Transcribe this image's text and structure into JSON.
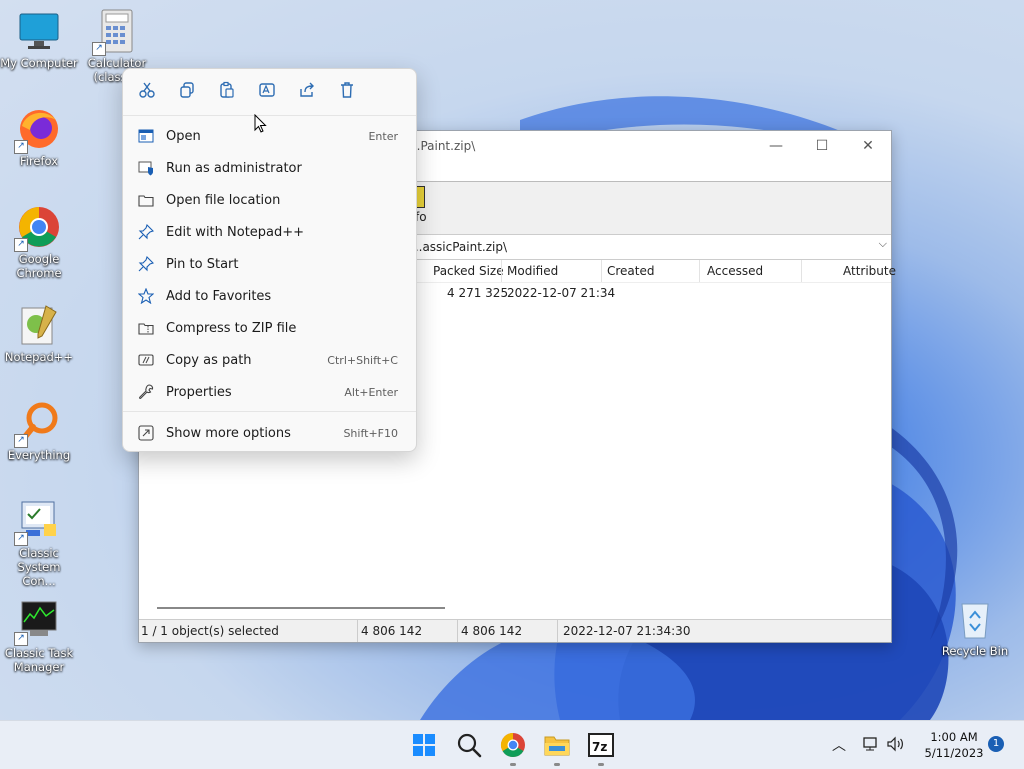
{
  "desktop": {
    "icons": [
      {
        "label": "My Computer"
      },
      {
        "label": "Calculator (classic)"
      },
      {
        "label": "Firefox"
      },
      {
        "label": "Google Chrome"
      },
      {
        "label": "Notepad++"
      },
      {
        "label": "Everything"
      },
      {
        "label": "Classic System Con..."
      },
      {
        "label": "Classic Task Manager"
      },
      {
        "label": "Recycle Bin"
      }
    ]
  },
  "window": {
    "title": "...Paint.zip\\",
    "toolbar_info_label": "fo",
    "address_path": "...assicPaint.zip\\",
    "columns": [
      "Packed Size",
      "Modified",
      "Created",
      "Accessed",
      "Attribute"
    ],
    "row": {
      "packed_size": "4 271 325",
      "modified": "2022-12-07 21:34"
    },
    "status": {
      "selected": "1 / 1 object(s) selected",
      "size": "4 806 142",
      "packed": "4 806 142",
      "date": "2022-12-07 21:34:30"
    }
  },
  "context_menu": {
    "quick_actions": [
      "cut-icon",
      "copy-icon",
      "paste-icon",
      "rename-icon",
      "share-icon",
      "delete-icon"
    ],
    "items": [
      {
        "label": "Open",
        "shortcut": "Enter",
        "icon": "open-icon"
      },
      {
        "label": "Run as administrator",
        "shortcut": "",
        "icon": "shield-icon"
      },
      {
        "label": "Open file location",
        "shortcut": "",
        "icon": "folder-icon"
      },
      {
        "label": "Edit with Notepad++",
        "shortcut": "",
        "icon": "pin-icon"
      },
      {
        "label": "Pin to Start",
        "shortcut": "",
        "icon": "pin-icon"
      },
      {
        "label": "Add to Favorites",
        "shortcut": "",
        "icon": "star-icon"
      },
      {
        "label": "Compress to ZIP file",
        "shortcut": "",
        "icon": "zip-icon"
      },
      {
        "label": "Copy as path",
        "shortcut": "Ctrl+Shift+C",
        "icon": "copy-path-icon"
      },
      {
        "label": "Properties",
        "shortcut": "Alt+Enter",
        "icon": "wrench-icon"
      },
      {
        "label": "Show more options",
        "shortcut": "Shift+F10",
        "icon": "more-options-icon"
      }
    ]
  },
  "taskbar": {
    "time": "1:00 AM",
    "date": "5/11/2023",
    "notification_count": "1"
  },
  "colors": {
    "accent": "#1a5fb4",
    "menu_bg": "#f9f9f9"
  }
}
